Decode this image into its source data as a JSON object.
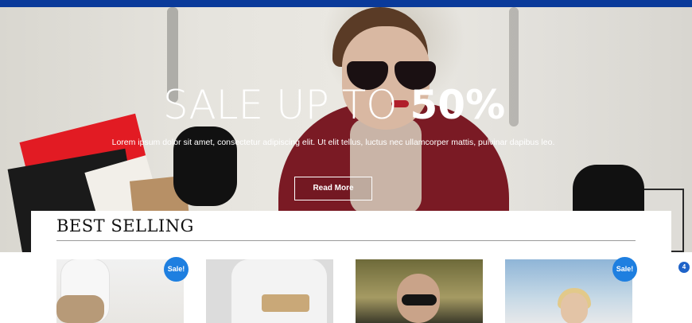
{
  "hero": {
    "title_light": "SALE UP TO",
    "title_bold": "50%",
    "subtitle": "Lorem ipsum dolor sit amet, consectetur adipiscing elit. Ut elit tellus, luctus nec ullamcorper mattis, pulvinar dapibus leo.",
    "button_label": "Read More"
  },
  "best_selling": {
    "title": "BEST SELLING",
    "products": [
      {
        "badge": "Sale!"
      },
      {
        "badge": ""
      },
      {
        "badge": ""
      },
      {
        "badge": "Sale!"
      }
    ]
  },
  "cart": {
    "count": "4"
  },
  "colors": {
    "topbar": "#0a3a9a",
    "badge": "#1e7fe0",
    "accent_red": "#7a1a24"
  }
}
